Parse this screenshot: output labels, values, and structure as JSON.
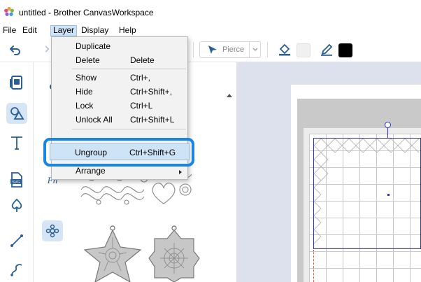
{
  "window": {
    "title": "untitled - Brother CanvasWorkspace"
  },
  "menubar": {
    "items": [
      "File",
      "Edit",
      "Layer",
      "Display",
      "Help"
    ],
    "active": "Layer"
  },
  "toolbar": {
    "pierce_label": "Pierce",
    "icons": [
      "undo-icon",
      "redo-icon",
      "pierce-icon",
      "fill-bucket-icon",
      "pen-icon"
    ],
    "fill_color": "#f0f0f0",
    "line_color": "#000000"
  },
  "layer_menu": {
    "items": [
      {
        "label": "Duplicate",
        "shortcut": ""
      },
      {
        "label": "Delete",
        "shortcut": "Delete"
      },
      {
        "label": "Show",
        "shortcut": "Ctrl+,"
      },
      {
        "label": "Hide",
        "shortcut": "Ctrl+Shift+,"
      },
      {
        "label": "Lock",
        "shortcut": "Ctrl+L"
      },
      {
        "label": "Unlock All",
        "shortcut": "Ctrl+Shift+L"
      },
      {
        "label": "Ungroup",
        "shortcut": "Ctrl+Shift+G"
      },
      {
        "label": "Arrange",
        "shortcut": ""
      }
    ],
    "highlighted": "Ungroup"
  },
  "colors": {
    "accent": "#1b86e0",
    "selection": "#2d2dd0",
    "menu_highlight": "#cfe3f7",
    "canvas_bg": "#dde1ee",
    "rail_selected": "#d5e5f6"
  },
  "tool_rail": {
    "icons": [
      "layers-icon",
      "shapes-icon",
      "text-icon",
      "svg-file-icon",
      "spade-shape-icon",
      "line-tool-icon",
      "curve-tool-icon"
    ],
    "selected": "shapes-icon"
  }
}
